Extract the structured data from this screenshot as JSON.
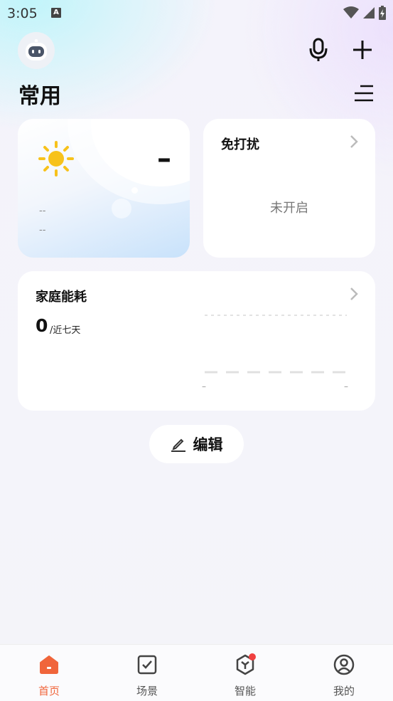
{
  "status_bar": {
    "time": "3:05",
    "notification_glyph": "A"
  },
  "header": {
    "avatar": "robot-avatar-icon",
    "voice_icon": "microphone-icon",
    "add_icon": "plus-icon",
    "menu_icon": "list-menu-icon"
  },
  "page": {
    "title": "常用"
  },
  "weather_card": {
    "temperature": "–",
    "line1": "--",
    "line2": "--",
    "icon": "sun-icon"
  },
  "dnd_card": {
    "title": "免打扰",
    "state": "未开启"
  },
  "energy_card": {
    "title": "家庭能耗",
    "value": "0",
    "period": "/近七天",
    "x_start": "–",
    "x_end": "–"
  },
  "edit_button": {
    "label": "编辑",
    "icon": "pencil-icon"
  },
  "tabs": [
    {
      "label": "首页",
      "icon": "home-icon",
      "active": true
    },
    {
      "label": "场景",
      "icon": "scene-checkbox-icon",
      "active": false
    },
    {
      "label": "智能",
      "icon": "smart-cube-icon",
      "active": false,
      "badge": true
    },
    {
      "label": "我的",
      "icon": "user-profile-icon",
      "active": false
    }
  ],
  "colors": {
    "accent": "#f0653b",
    "sun": "#f7c21b",
    "badge": "#f04040"
  }
}
